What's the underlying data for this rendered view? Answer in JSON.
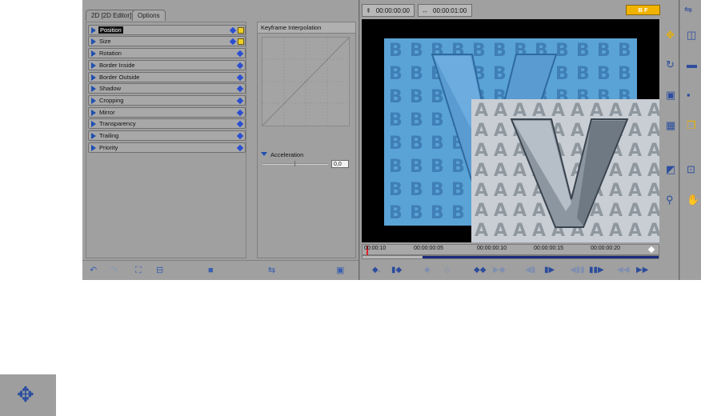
{
  "tabs": [
    {
      "label": "2D [2D Editor]",
      "active": true
    },
    {
      "label": "Options",
      "active": false
    }
  ],
  "params": [
    {
      "label": "Position",
      "selected": true,
      "has_key": true
    },
    {
      "label": "Size",
      "selected": false,
      "has_key": true
    },
    {
      "label": "Rotation",
      "selected": false,
      "has_key": false
    },
    {
      "label": "Border Inside",
      "selected": false,
      "has_key": false
    },
    {
      "label": "Border Outside",
      "selected": false,
      "has_key": false
    },
    {
      "label": "Shadow",
      "selected": false,
      "has_key": false
    },
    {
      "label": "Cropping",
      "selected": false,
      "has_key": false
    },
    {
      "label": "Mirror",
      "selected": false,
      "has_key": false
    },
    {
      "label": "Transparency",
      "selected": false,
      "has_key": false
    },
    {
      "label": "Trailing",
      "selected": false,
      "has_key": false
    },
    {
      "label": "Priority",
      "selected": false,
      "has_key": false
    }
  ],
  "keyframe": {
    "title": "Keyframe Interpolation",
    "acceleration_label": "Acceleration",
    "acceleration_value": "0,0"
  },
  "timecodes": {
    "current": "00:00:00:00",
    "duration": "00:00:01:00"
  },
  "bf_button": "B F",
  "ruler": {
    "labels": [
      "00:00:10",
      "00:00:00:05",
      "00:00:00:10",
      "00:00:00:15",
      "00:00:00:20"
    ]
  },
  "preview": {
    "letter_b": "B",
    "letter_a": "A",
    "letter_v": "V"
  },
  "icons": {
    "move": "move-icon"
  },
  "colors": {
    "panel_bg": "#a0a0a0",
    "accent_blue": "#1f4fb0",
    "key_yellow": "#f2b300"
  }
}
